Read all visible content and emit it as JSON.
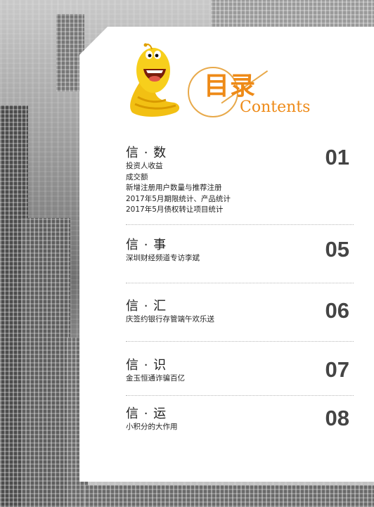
{
  "header": {
    "title": "目录",
    "subtitle": "Contents"
  },
  "sections": [
    {
      "title": "信 · 数",
      "number": "01",
      "items": [
        "投资人收益",
        "成交额",
        "新增注册用户数量与推荐注册",
        "2017年5月期限统计、产品统计",
        "2017年5月债权转让项目统计"
      ]
    },
    {
      "title": "信 · 事",
      "number": "05",
      "items": [
        "深圳财经频道专访李斌"
      ]
    },
    {
      "title": "信 · 汇",
      "number": "06",
      "items": [
        "庆签约银行存管端午欢乐送"
      ]
    },
    {
      "title": "信 · 识",
      "number": "07",
      "items": [
        "金玉恒通诈骗百亿"
      ]
    },
    {
      "title": "信 · 运",
      "number": "08",
      "items": [
        "小积分的大作用"
      ]
    }
  ]
}
